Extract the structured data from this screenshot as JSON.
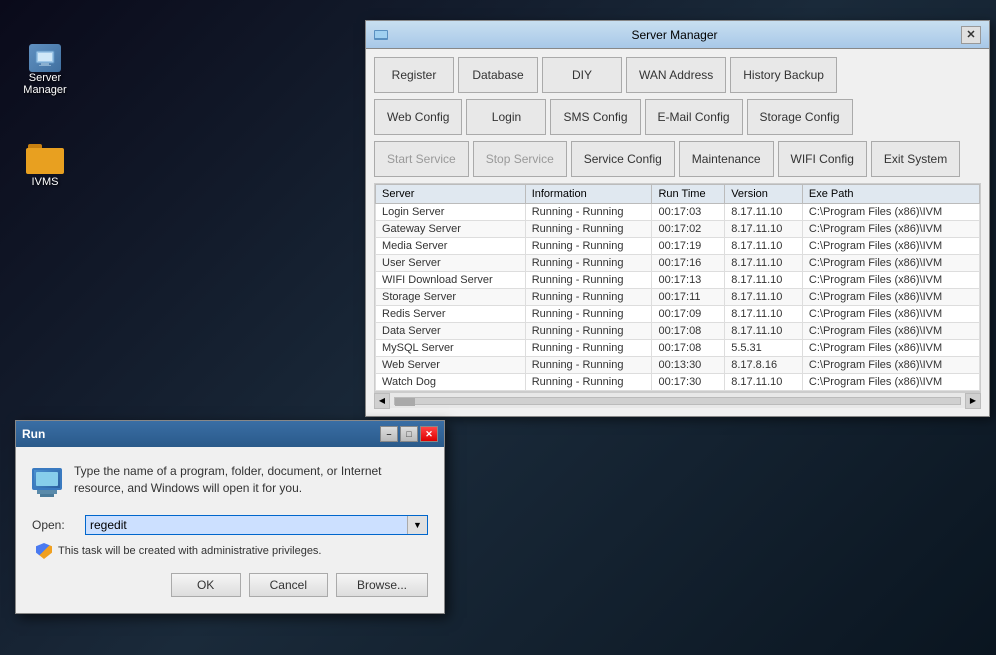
{
  "desktop": {
    "background": "#0a1520"
  },
  "icons": [
    {
      "id": "server-manager-icon",
      "label": "Server\nManager",
      "type": "folder"
    },
    {
      "id": "ivms-icon",
      "label": "IVMS",
      "type": "folder-yellow"
    }
  ],
  "server_manager_window": {
    "title": "Server Manager",
    "close_btn": "✕",
    "toolbar_rows": [
      [
        {
          "id": "register-btn",
          "label": "Register",
          "disabled": false
        },
        {
          "id": "database-btn",
          "label": "Database",
          "disabled": false
        },
        {
          "id": "diy-btn",
          "label": "DIY",
          "disabled": false
        },
        {
          "id": "wan-address-btn",
          "label": "WAN Address",
          "disabled": false
        },
        {
          "id": "history-backup-btn",
          "label": "History Backup",
          "disabled": false
        }
      ],
      [
        {
          "id": "web-config-btn",
          "label": "Web Config",
          "disabled": false
        },
        {
          "id": "login-btn",
          "label": "Login",
          "disabled": false
        },
        {
          "id": "sms-config-btn",
          "label": "SMS Config",
          "disabled": false
        },
        {
          "id": "email-config-btn",
          "label": "E-Mail Config",
          "disabled": false
        },
        {
          "id": "storage-config-btn",
          "label": "Storage Config",
          "disabled": false
        }
      ],
      [
        {
          "id": "start-service-btn",
          "label": "Start Service",
          "disabled": true
        },
        {
          "id": "stop-service-btn",
          "label": "Stop Service",
          "disabled": true
        },
        {
          "id": "service-config-btn",
          "label": "Service Config",
          "disabled": false
        },
        {
          "id": "maintenance-btn",
          "label": "Maintenance",
          "disabled": false
        },
        {
          "id": "wifi-config-btn",
          "label": "WIFI Config",
          "disabled": false
        },
        {
          "id": "exit-system-btn",
          "label": "Exit System",
          "disabled": false
        }
      ]
    ],
    "table": {
      "headers": [
        "Server",
        "Information",
        "Run Time",
        "Version",
        "Exe Path"
      ],
      "rows": [
        {
          "server": "Login Server",
          "info": "Running - Running",
          "runtime": "00:17:03",
          "version": "8.17.11.10",
          "path": "C:\\Program Files (x86)\\IVM"
        },
        {
          "server": "Gateway Server",
          "info": "Running - Running",
          "runtime": "00:17:02",
          "version": "8.17.11.10",
          "path": "C:\\Program Files (x86)\\IVM"
        },
        {
          "server": "Media Server",
          "info": "Running - Running",
          "runtime": "00:17:19",
          "version": "8.17.11.10",
          "path": "C:\\Program Files (x86)\\IVM"
        },
        {
          "server": "User Server",
          "info": "Running - Running",
          "runtime": "00:17:16",
          "version": "8.17.11.10",
          "path": "C:\\Program Files (x86)\\IVM"
        },
        {
          "server": "WIFI Download Server",
          "info": "Running - Running",
          "runtime": "00:17:13",
          "version": "8.17.11.10",
          "path": "C:\\Program Files (x86)\\IVM"
        },
        {
          "server": "Storage Server",
          "info": "Running - Running",
          "runtime": "00:17:11",
          "version": "8.17.11.10",
          "path": "C:\\Program Files (x86)\\IVM"
        },
        {
          "server": "Redis Server",
          "info": "Running - Running",
          "runtime": "00:17:09",
          "version": "8.17.11.10",
          "path": "C:\\Program Files (x86)\\IVM"
        },
        {
          "server": "Data Server",
          "info": "Running - Running",
          "runtime": "00:17:08",
          "version": "8.17.11.10",
          "path": "C:\\Program Files (x86)\\IVM"
        },
        {
          "server": "MySQL Server",
          "info": "Running - Running",
          "runtime": "00:17:08",
          "version": "5.5.31",
          "path": "C:\\Program Files (x86)\\IVM"
        },
        {
          "server": "Web Server",
          "info": "Running - Running",
          "runtime": "00:13:30",
          "version": "8.17.8.16",
          "path": "C:\\Program Files (x86)\\IVM"
        },
        {
          "server": "Watch Dog",
          "info": "Running - Running",
          "runtime": "00:17:30",
          "version": "8.17.11.10",
          "path": "C:\\Program Files (x86)\\IVM"
        }
      ]
    }
  },
  "run_dialog": {
    "title": "Run",
    "description": "Type the name of a program, folder, document, or Internet resource, and Windows will open it for you.",
    "open_label": "Open:",
    "input_value": "regedit",
    "input_placeholder": "regedit",
    "admin_notice": "This task will be created with administrative privileges.",
    "ok_label": "OK",
    "cancel_label": "Cancel",
    "browse_label": "Browse..."
  }
}
